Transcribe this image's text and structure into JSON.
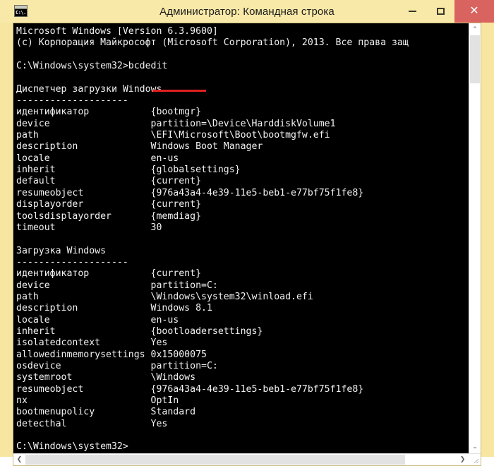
{
  "window": {
    "title": "Администратор: Командная строка",
    "icon": "console-icon",
    "icon_text": "C:\\.",
    "controls": {
      "minimize": "–",
      "maximize": "▢",
      "close": "✕"
    },
    "colors": {
      "frame": "#f7e6a0",
      "titlebar": "#f9e9a8",
      "close_button": "#d9635f",
      "console_background": "#000000",
      "console_text": "#f2f2f2",
      "annotation_underline": "#e02020"
    }
  },
  "console": {
    "lines": [
      "Microsoft Windows [Version 6.3.9600]",
      "(c) Корпорация Майкрософт (Microsoft Corporation), 2013. Все права защ",
      "",
      "C:\\Windows\\system32>bcdedit",
      "",
      "Диспетчер загрузки Windows",
      "--------------------",
      "идентификатор           {bootmgr}",
      "device                  partition=\\Device\\HarddiskVolume1",
      "path                    \\EFI\\Microsoft\\Boot\\bootmgfw.efi",
      "description             Windows Boot Manager",
      "locale                  en-us",
      "inherit                 {globalsettings}",
      "default                 {current}",
      "resumeobject            {976a43a4-4e39-11e5-beb1-e77bf75f1fe8}",
      "displayorder            {current}",
      "toolsdisplayorder       {memdiag}",
      "timeout                 30",
      "",
      "Загрузка Windows",
      "--------------------",
      "идентификатор           {current}",
      "device                  partition=C:",
      "path                    \\Windows\\system32\\winload.efi",
      "description             Windows 8.1",
      "locale                  en-us",
      "inherit                 {bootloadersettings}",
      "isolatedcontext         Yes",
      "allowedinmemorysettings 0x15000075",
      "osdevice                partition=C:",
      "systemroot              \\Windows",
      "resumeobject            {976a43a4-4e39-11e5-beb1-e77bf75f1fe8}",
      "nx                      OptIn",
      "bootmenupolicy          Standard",
      "detecthal               Yes",
      "",
      "C:\\Windows\\system32>"
    ],
    "command_entered": "bcdedit",
    "prompt": "C:\\Windows\\system32>"
  },
  "scrollbars": {
    "vertical": {
      "up_arrow": "⌃",
      "down_arrow": "⌄"
    },
    "horizontal": {
      "left_arrow": "❮",
      "right_arrow": "❯"
    }
  }
}
